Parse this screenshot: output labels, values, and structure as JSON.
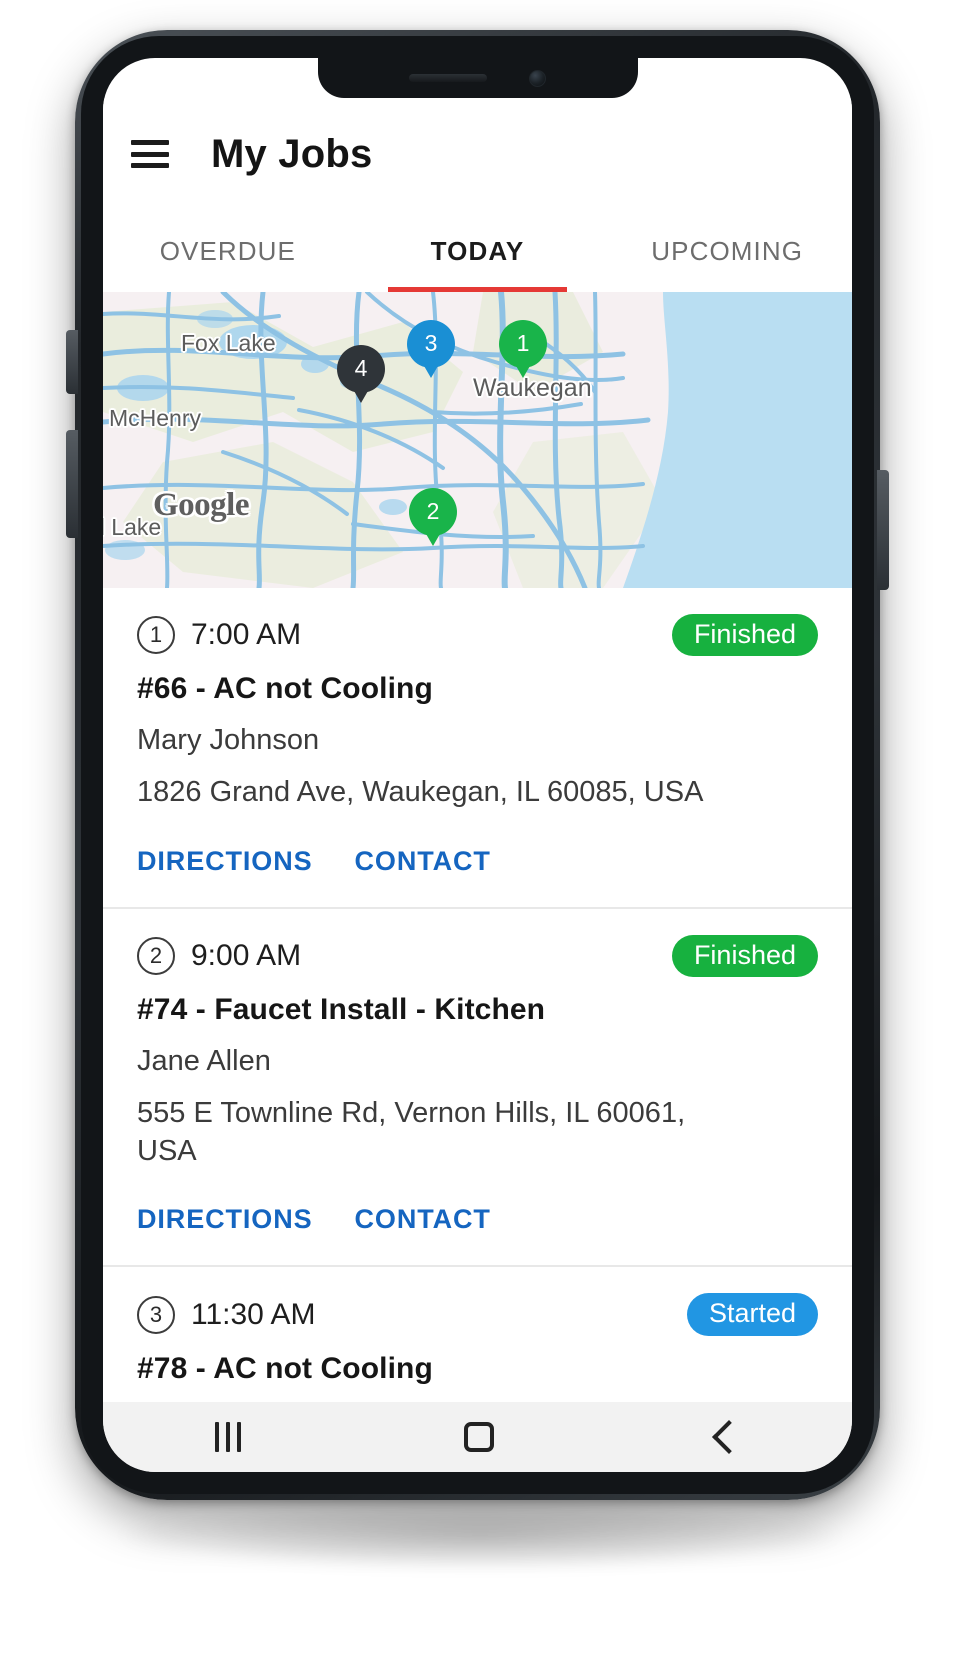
{
  "app": {
    "title": "My Jobs",
    "menu_icon": "hamburger-menu-icon"
  },
  "tabs": [
    {
      "label": "OVERDUE",
      "active": false
    },
    {
      "label": "TODAY",
      "active": true
    },
    {
      "label": "UPCOMING",
      "active": false
    }
  ],
  "map": {
    "provider_logo": "Google",
    "labels": [
      {
        "name": "Fox Lake"
      },
      {
        "name": "McHenry"
      },
      {
        "name": "al Lake"
      },
      {
        "name": "Waukegan"
      }
    ],
    "pins": [
      {
        "number": "1",
        "color": "#19b44a"
      },
      {
        "number": "2",
        "color": "#19b44a"
      },
      {
        "number": "3",
        "color": "#1a8fd4"
      },
      {
        "number": "4",
        "color": "#2f3439"
      }
    ]
  },
  "jobs": [
    {
      "seq": "1",
      "time": "7:00 AM",
      "status": "Finished",
      "status_color": "#17b13f",
      "title": "#66 - AC not Cooling",
      "customer": "Mary Johnson",
      "address": "1826 Grand Ave, Waukegan, IL 60085, USA",
      "actions": [
        "DIRECTIONS",
        "CONTACT"
      ]
    },
    {
      "seq": "2",
      "time": "9:00 AM",
      "status": "Finished",
      "status_color": "#17b13f",
      "title": "#74 - Faucet Install - Kitchen",
      "customer": "Jane Allen",
      "address": "555 E Townline Rd, Vernon Hills, IL 60061, USA",
      "actions": [
        "DIRECTIONS",
        "CONTACT"
      ]
    },
    {
      "seq": "3",
      "time": "11:30 AM",
      "status": "Started",
      "status_color": "#2196e3",
      "title": "#78 - AC not Cooling",
      "customer": "",
      "address": "",
      "actions": []
    }
  ],
  "navbar": {
    "recents": "recents-icon",
    "home": "home-icon",
    "back": "back-icon"
  }
}
